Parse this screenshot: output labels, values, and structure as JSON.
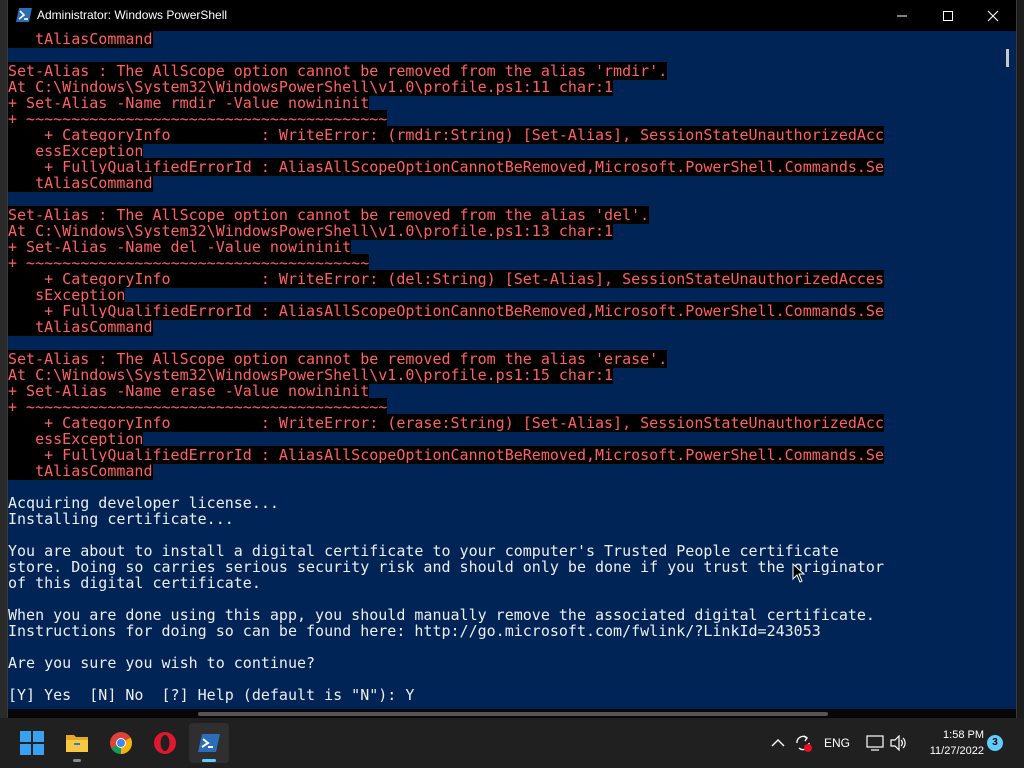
{
  "window": {
    "title": "Administrator: Windows PowerShell",
    "background": "#012456",
    "error_color": "#ff6060",
    "text_color": "#eeedf0"
  },
  "console_lines": [
    {
      "t": "   tAliasCommand",
      "c": "cont"
    },
    {
      "t": "",
      "c": "out"
    },
    {
      "t": "Set-Alias : The AllScope option cannot be removed from the alias 'rmdir'.",
      "c": "err"
    },
    {
      "t": "At C:\\Windows\\System32\\WindowsPowerShell\\v1.0\\profile.ps1:11 char:1",
      "c": "err"
    },
    {
      "t": "+ Set-Alias -Name rmdir -Value nowininit",
      "c": "err"
    },
    {
      "t": "+ ~~~~~~~~~~~~~~~~~~~~~~~~~~~~~~~~~~~~~~~~",
      "c": "err"
    },
    {
      "t": "    + CategoryInfo          : WriteError: (rmdir:String) [Set-Alias], SessionStateUnauthorizedAcc",
      "c": "err"
    },
    {
      "t": "   essException",
      "c": "cont"
    },
    {
      "t": "    + FullyQualifiedErrorId : AliasAllScopeOptionCannotBeRemoved,Microsoft.PowerShell.Commands.Se",
      "c": "err"
    },
    {
      "t": "   tAliasCommand",
      "c": "cont"
    },
    {
      "t": "",
      "c": "out"
    },
    {
      "t": "Set-Alias : The AllScope option cannot be removed from the alias 'del'.",
      "c": "err"
    },
    {
      "t": "At C:\\Windows\\System32\\WindowsPowerShell\\v1.0\\profile.ps1:13 char:1",
      "c": "err"
    },
    {
      "t": "+ Set-Alias -Name del -Value nowininit",
      "c": "err"
    },
    {
      "t": "+ ~~~~~~~~~~~~~~~~~~~~~~~~~~~~~~~~~~~~~~",
      "c": "err"
    },
    {
      "t": "    + CategoryInfo          : WriteError: (del:String) [Set-Alias], SessionStateUnauthorizedAcces",
      "c": "err"
    },
    {
      "t": "   sException",
      "c": "cont"
    },
    {
      "t": "    + FullyQualifiedErrorId : AliasAllScopeOptionCannotBeRemoved,Microsoft.PowerShell.Commands.Se",
      "c": "err"
    },
    {
      "t": "   tAliasCommand",
      "c": "cont"
    },
    {
      "t": "",
      "c": "out"
    },
    {
      "t": "Set-Alias : The AllScope option cannot be removed from the alias 'erase'.",
      "c": "err"
    },
    {
      "t": "At C:\\Windows\\System32\\WindowsPowerShell\\v1.0\\profile.ps1:15 char:1",
      "c": "err"
    },
    {
      "t": "+ Set-Alias -Name erase -Value nowininit",
      "c": "err"
    },
    {
      "t": "+ ~~~~~~~~~~~~~~~~~~~~~~~~~~~~~~~~~~~~~~~~",
      "c": "err"
    },
    {
      "t": "    + CategoryInfo          : WriteError: (erase:String) [Set-Alias], SessionStateUnauthorizedAcc",
      "c": "err"
    },
    {
      "t": "   essException",
      "c": "cont"
    },
    {
      "t": "    + FullyQualifiedErrorId : AliasAllScopeOptionCannotBeRemoved,Microsoft.PowerShell.Commands.Se",
      "c": "err"
    },
    {
      "t": "   tAliasCommand",
      "c": "cont"
    },
    {
      "t": "",
      "c": "out"
    },
    {
      "t": "Acquiring developer license...",
      "c": "out"
    },
    {
      "t": "Installing certificate...",
      "c": "out"
    },
    {
      "t": "",
      "c": "out"
    },
    {
      "t": "You are about to install a digital certificate to your computer's Trusted People certificate",
      "c": "out"
    },
    {
      "t": "store. Doing so carries serious security risk and should only be done if you trust the originator",
      "c": "out"
    },
    {
      "t": "of this digital certificate.",
      "c": "out"
    },
    {
      "t": "",
      "c": "out"
    },
    {
      "t": "When you are done using this app, you should manually remove the associated digital certificate.",
      "c": "out"
    },
    {
      "t": "Instructions for doing so can be found here: http://go.microsoft.com/fwlink/?LinkId=243053",
      "c": "out"
    },
    {
      "t": "",
      "c": "out"
    },
    {
      "t": "Are you sure you wish to continue?",
      "c": "out"
    },
    {
      "t": "",
      "c": "out"
    },
    {
      "t": "[Y] Yes  [N] No  [?] Help (default is \"N\"): Y",
      "c": "out"
    }
  ],
  "taskbar": {
    "apps": [
      {
        "name": "start-button",
        "icon": "windows-logo-icon"
      },
      {
        "name": "file-explorer",
        "icon": "folder-icon"
      },
      {
        "name": "chrome",
        "icon": "chrome-icon"
      },
      {
        "name": "opera",
        "icon": "opera-icon"
      },
      {
        "name": "powershell",
        "icon": "powershell-icon",
        "active": true
      }
    ],
    "tray": {
      "language": "ENG",
      "time": "1:58 PM",
      "date": "11/27/2022",
      "notification_count": "3"
    }
  }
}
